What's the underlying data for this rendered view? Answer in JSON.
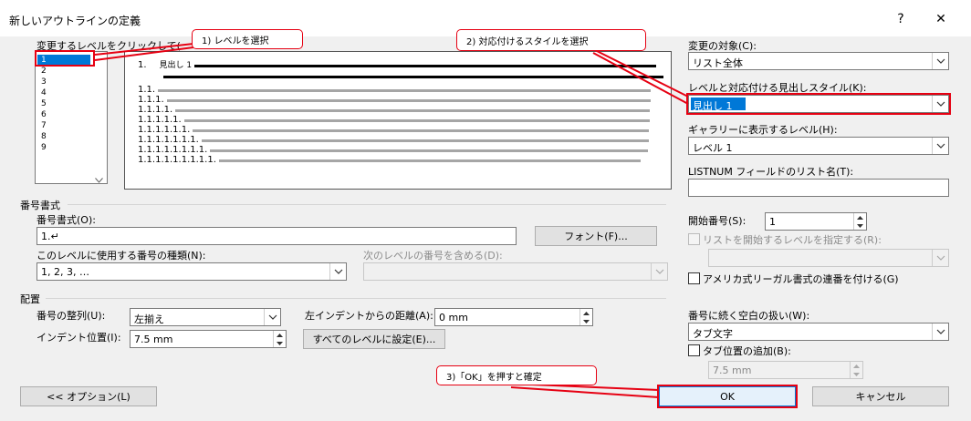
{
  "window": {
    "title": "新しいアウトラインの定義",
    "help_icon": "?",
    "close_icon": "✕"
  },
  "level_list": {
    "label": "変更するレベルをクリックして(",
    "items": [
      "1",
      "2",
      "3",
      "4",
      "5",
      "6",
      "7",
      "8",
      "9"
    ],
    "selected": "1"
  },
  "preview": {
    "rows": [
      {
        "num": "1.",
        "text": "見出し 1"
      },
      {
        "num": "1.1.",
        "text": ""
      },
      {
        "num": "1.1.1.",
        "text": ""
      },
      {
        "num": "1.1.1.1.",
        "text": ""
      },
      {
        "num": "1.1.1.1.1.",
        "text": ""
      },
      {
        "num": "1.1.1.1.1.1.",
        "text": ""
      },
      {
        "num": "1.1.1.1.1.1.1.",
        "text": ""
      },
      {
        "num": "1.1.1.1.1.1.1.1.",
        "text": ""
      },
      {
        "num": "1.1.1.1.1.1.1.1.1.",
        "text": ""
      }
    ]
  },
  "right_panel": {
    "apply_to_label": "変更の対象(C):",
    "apply_to_value": "リスト全体",
    "link_style_label": "レベルと対応付ける見出しスタイル(K):",
    "link_style_value": "見出し 1",
    "gallery_level_label": "ギャラリーに表示するレベル(H):",
    "gallery_level_value": "レベル 1",
    "listnum_label": "LISTNUM フィールドのリスト名(T):",
    "listnum_value": ""
  },
  "number_format": {
    "section": "番号書式",
    "format_label": "番号書式(O):",
    "format_value": "1.↵",
    "font_button": "フォント(F)...",
    "style_label": "このレベルに使用する番号の種類(N):",
    "style_value": "1, 2, 3, …",
    "include_label": "次のレベルの番号を含める(D):",
    "include_value": "",
    "start_at_label": "開始番号(S):",
    "start_at_value": "1",
    "restart_label": "リストを開始するレベルを指定する(R):",
    "restart_value": "",
    "legal_label": "アメリカ式リーガル書式の連番を付ける(G)"
  },
  "position": {
    "section": "配置",
    "alignment_label": "番号の整列(U):",
    "alignment_value": "左揃え",
    "aligned_at_label": "左インデントからの距離(A):",
    "aligned_at_value": "0 mm",
    "indent_label": "インデント位置(I):",
    "indent_value": "7.5 mm",
    "set_all_button": "すべてのレベルに設定(E)...",
    "follow_label": "番号に続く空白の扱い(W):",
    "follow_value": "タブ文字",
    "tab_stop_label": "タブ位置の追加(B):",
    "tab_stop_value": "7.5 mm"
  },
  "buttons": {
    "options": "<< オプション(L)",
    "ok": "OK",
    "cancel": "キャンセル"
  },
  "callouts": {
    "c1": "1) レベルを選択",
    "c2": "2) 対応付けるスタイルを選択",
    "c3": "3)「OK」を押すと確定"
  },
  "colors": {
    "annotation_red": "#e60012",
    "selection_blue": "#0078d7"
  }
}
